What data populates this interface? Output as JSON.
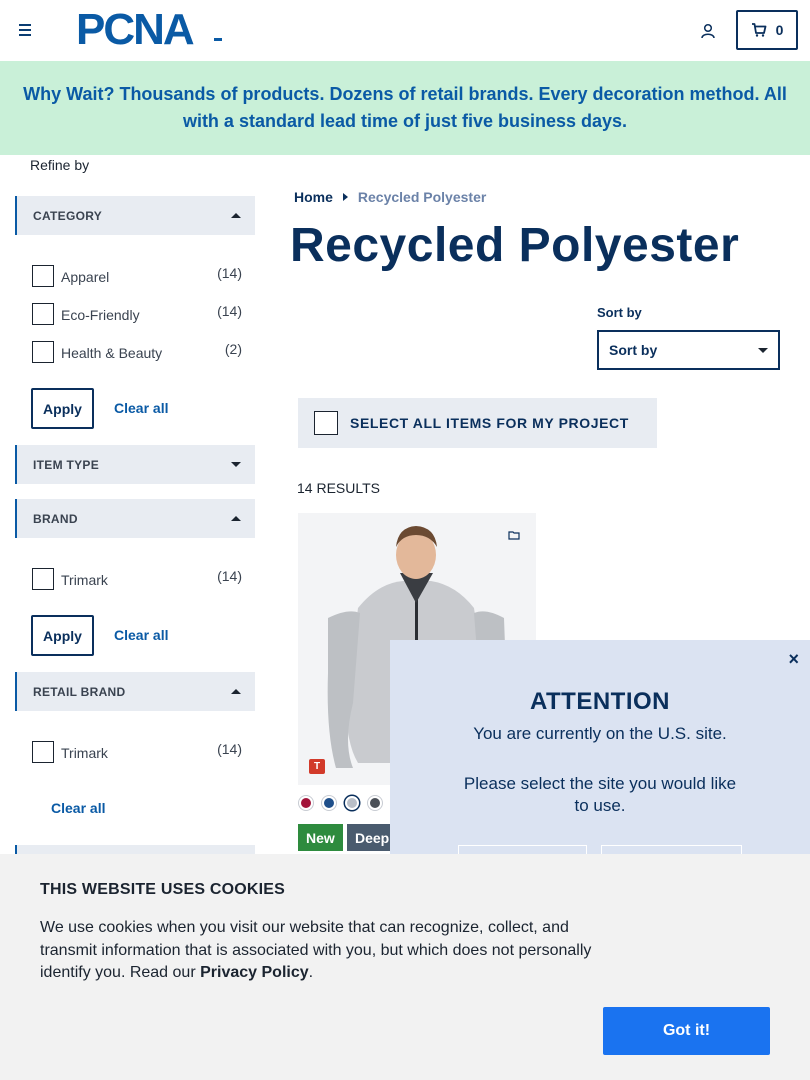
{
  "header": {
    "logo_text": "PCNA",
    "cart_count": "0"
  },
  "banner": {
    "text": "Why Wait? Thousands of products. Dozens of retail brands. Every decoration method. All with a standard lead time of just five business days."
  },
  "sidebar": {
    "refine_label": "Refine by",
    "facets": [
      {
        "title": "CATEGORY",
        "state": "expanded",
        "options": [
          {
            "label": "Apparel",
            "count": "(14)"
          },
          {
            "label": "Eco-Friendly",
            "count": "(14)"
          },
          {
            "label": "Health & Beauty",
            "count": "(2)"
          }
        ]
      },
      {
        "title": "ITEM TYPE",
        "state": "collapsed"
      },
      {
        "title": "BRAND",
        "state": "expanded",
        "options": [
          {
            "label": "Trimark",
            "count": "(14)"
          }
        ]
      },
      {
        "title": "RETAIL BRAND",
        "state": "expanded",
        "options": [
          {
            "label": "Trimark",
            "count": "(14)"
          }
        ]
      }
    ],
    "apply_label": "Apply",
    "clear_label": "Clear all"
  },
  "breadcrumb": {
    "home": "Home",
    "current": "Recycled Polyester"
  },
  "page_title": "Recycled Polyester",
  "sort": {
    "label": "Sort by",
    "selected": "Sort by"
  },
  "select_all_label": "SELECT ALL ITEMS FOR MY PROJECT",
  "results_count": "14 RESULTS",
  "product": {
    "brand_mark": "T",
    "swatch_colors": [
      "#a3133a",
      "#1f4f8a",
      "#b9bfc8",
      "#4a4f57"
    ],
    "badges": [
      {
        "label": "New",
        "color": "#2e8b3e"
      },
      {
        "label": "Deep",
        "color": "#4a5b6e"
      }
    ]
  },
  "modal": {
    "close": "×",
    "heading": "ATTENTION",
    "line1": "You are currently on the U.S. site.",
    "line2": "Please select the site you would like to use."
  },
  "cookie": {
    "heading": "THIS WEBSITE USES COOKIES",
    "text": "We use cookies when you visit our website that can recognize, collect, and transmit information that is associated with you, but which does not personally identify you. Read our",
    "link": "Privacy Policy",
    "period": ".",
    "button": "Got it!"
  }
}
